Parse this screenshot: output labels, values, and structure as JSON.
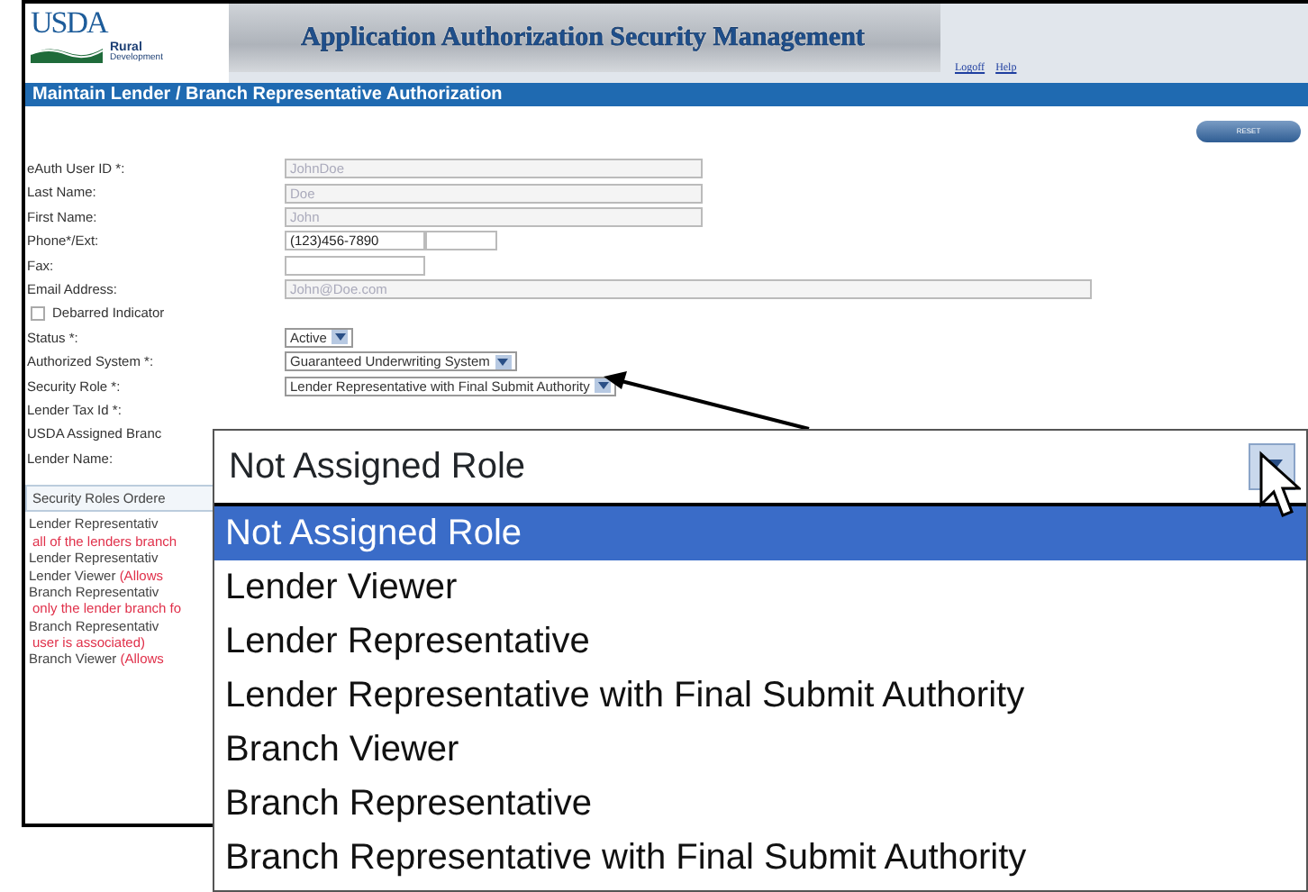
{
  "header": {
    "logo": "USDA",
    "agency": "Rural",
    "agency_sub": "Development",
    "title": "Application Authorization Security Management",
    "links": [
      "Logoff",
      "Help"
    ]
  },
  "page_title": "Maintain Lender / Branch Representative Authorization",
  "reset_button": "RESET",
  "fields": [
    {
      "kind": "text",
      "label": "eAuth User ID *:",
      "value": "JohnDoe",
      "disabled": true
    },
    {
      "kind": "text",
      "label": "Last Name:",
      "value": "Doe",
      "disabled": true
    },
    {
      "kind": "text",
      "label": "First Name:",
      "value": "John",
      "disabled": true
    },
    {
      "kind": "phone",
      "label": "Phone*/Ext:",
      "value": "(123)456-7890",
      "disabled": false
    },
    {
      "kind": "short",
      "label": "Fax:"
    },
    {
      "kind": "email",
      "label": "Email Address:",
      "value": "John@Doe.com",
      "disabled": true
    },
    {
      "kind": "checkbox",
      "label": "Debarred Indicator",
      "checked": false
    },
    {
      "kind": "select",
      "label": "Status *:",
      "value": "Active"
    },
    {
      "kind": "select",
      "label": "Authorized System *:",
      "value": "Guaranteed Underwriting System"
    },
    {
      "kind": "select",
      "label": "Security Role *:",
      "value": "Lender Representative with Final Submit Authority"
    },
    {
      "kind": "label",
      "label": "Lender Tax Id *:"
    },
    {
      "kind": "label",
      "label": "USDA Assigned Branc"
    },
    {
      "kind": "label",
      "label": "Lender Name:"
    }
  ],
  "roles_panel": {
    "heading": "Security Roles Ordere",
    "items": [
      {
        "text": "Lender Representativ",
        "note": "all of the lenders branch"
      },
      {
        "text": "Lender Representativ"
      },
      {
        "text": "Lender Viewer",
        "note": "(Allows"
      },
      {
        "text": "Branch Representativ",
        "note": "only the lender branch fo"
      },
      {
        "text": "Branch Representativ",
        "note": "user is associated)"
      },
      {
        "text": "Branch Viewer",
        "note": "(Allows"
      }
    ]
  },
  "callout": {
    "value": "Not Assigned Role",
    "options": [
      {
        "label": "Not Assigned Role",
        "selected": true
      },
      {
        "label": "Lender Viewer",
        "selected": false
      },
      {
        "label": "Lender Representative",
        "selected": false
      },
      {
        "label": "Lender Representative with Final Submit Authority",
        "selected": false
      },
      {
        "label": "Branch Viewer",
        "selected": false
      },
      {
        "label": "Branch Representative",
        "selected": false
      },
      {
        "label": "Branch Representative with Final Submit Authority",
        "selected": false
      }
    ]
  }
}
